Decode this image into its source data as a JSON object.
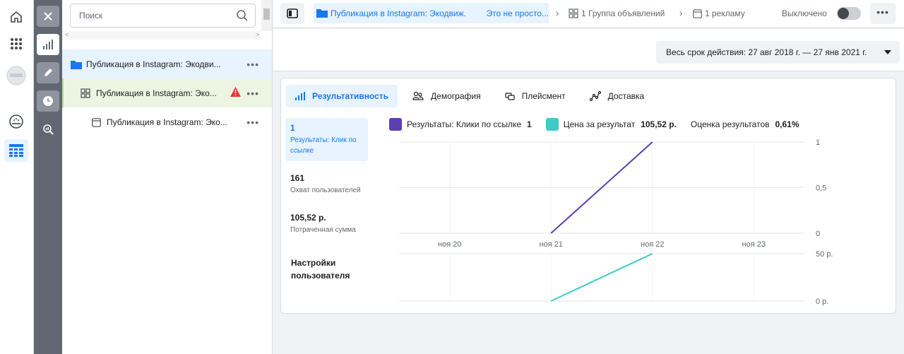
{
  "colors": {
    "accent": "#1877f2",
    "series_results": "#5b3fb3",
    "series_cost": "#3ccbc5",
    "warning": "#e4382f"
  },
  "global_nav": {
    "icons": [
      "home-icon",
      "apps-grid-icon",
      "account-avatar-icon",
      "dashboard-icon",
      "ads-table-icon"
    ]
  },
  "tool_rail": {
    "icons": [
      "close-icon",
      "bar-chart-icon",
      "pencil-icon",
      "clock-icon",
      "zoom-chart-icon"
    ]
  },
  "tree": {
    "search_placeholder": "Поиск",
    "scroll_left": "<",
    "scroll_right": ">",
    "campaign_label": "Публикация в Instagram: Экодви...",
    "adset_label": "Публикация в Instagram: Эко...",
    "ad_label": "Публикация в Instagram: Эко...",
    "more": "•••"
  },
  "header": {
    "campaign_crumb": "Публикация в Instagram: Экодвиж.",
    "campaign_crumb_suffix": "Это не просто...",
    "adset_crumb": "1 Группа объявлений",
    "ad_crumb": "1 рекламу",
    "status": "Выключено",
    "more": "•••"
  },
  "date_range": {
    "label": "Весь срок действия: 27 авг 2018 г. — 27 янв 2021 г."
  },
  "tabs": [
    {
      "label": "Результативность",
      "icon": "bar-chart-icon"
    },
    {
      "label": "Демография",
      "icon": "people-icon"
    },
    {
      "label": "Плейсмент",
      "icon": "placement-icon"
    },
    {
      "label": "Доставка",
      "icon": "delivery-icon"
    }
  ],
  "metrics": [
    {
      "value": "1",
      "label": "Результаты: Клик по ссылке"
    },
    {
      "value": "161",
      "label": "Охват пользователей"
    },
    {
      "value": "105,52 р.",
      "label": "Потраченная сумма"
    }
  ],
  "metric_settings": "Настройки пользователя",
  "legend": {
    "results_label": "Результаты: Клики по ссылке",
    "results_value": "1",
    "cost_label": "Цена за результат",
    "cost_value": "105,52 р.",
    "rating_label": "Оценка результатов",
    "rating_value": "0,61%"
  },
  "chart_data": [
    {
      "type": "line",
      "categories": [
        "ноя 20",
        "ноя 21",
        "ноя 22",
        "ноя 23"
      ],
      "ytick_labels": [
        "0",
        "0,5",
        "1"
      ],
      "ylim": [
        0,
        1
      ],
      "series": [
        {
          "name": "Результаты: Клики по ссылке",
          "x": [
            1,
            2
          ],
          "values": [
            0,
            1
          ]
        }
      ],
      "grid": true
    },
    {
      "type": "line",
      "categories": [
        "ноя 20",
        "ноя 21",
        "ноя 22",
        "ноя 23"
      ],
      "ytick_labels": [
        "0 р.",
        "50 р."
      ],
      "ylim": [
        0,
        50
      ],
      "series": [
        {
          "name": "Цена за результат",
          "x": [
            1,
            2
          ],
          "values": [
            0,
            50
          ]
        }
      ],
      "grid": true
    }
  ]
}
